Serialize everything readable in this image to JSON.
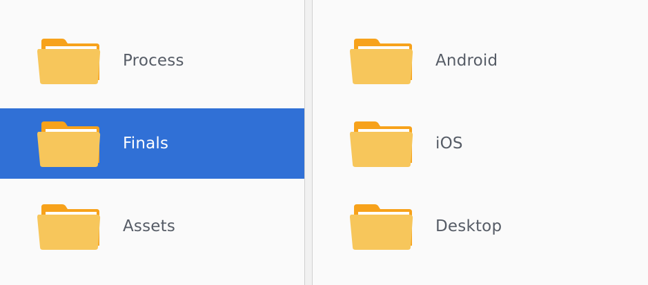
{
  "columns": {
    "left": {
      "items": [
        {
          "label": "Process",
          "selected": false,
          "icon": "folder-icon"
        },
        {
          "label": "Finals",
          "selected": true,
          "icon": "folder-icon"
        },
        {
          "label": "Assets",
          "selected": false,
          "icon": "folder-icon"
        }
      ]
    },
    "right": {
      "items": [
        {
          "label": "Android",
          "selected": false,
          "icon": "folder-icon"
        },
        {
          "label": "iOS",
          "selected": false,
          "icon": "folder-icon"
        },
        {
          "label": "Desktop",
          "selected": false,
          "icon": "folder-icon"
        }
      ]
    }
  },
  "colors": {
    "selection": "#3070d6",
    "folder_back": "#f7a21b",
    "folder_front": "#f7c65b",
    "label_text": "#565c66"
  }
}
